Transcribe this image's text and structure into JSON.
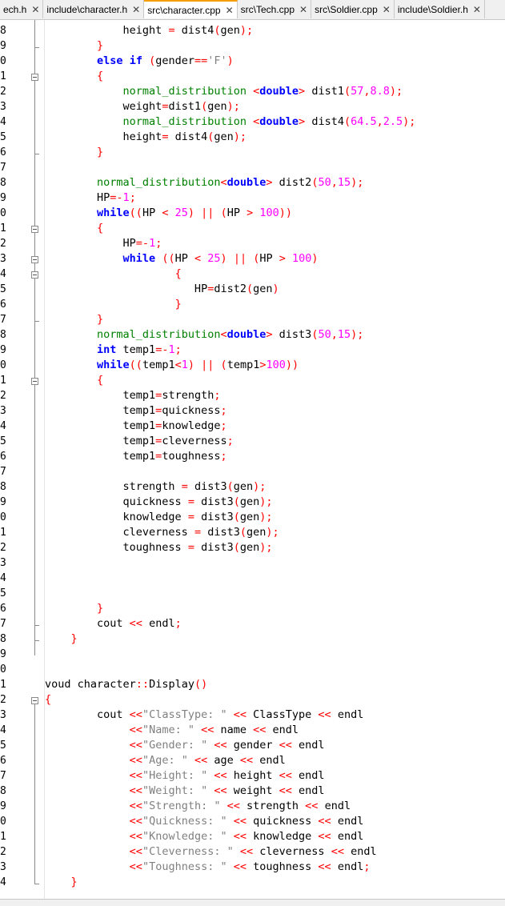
{
  "tabs": [
    {
      "label": "ech.h",
      "close": "✕",
      "active": false
    },
    {
      "label": "include\\character.h",
      "close": "✕",
      "active": false
    },
    {
      "label": "src\\character.cpp",
      "close": "✕",
      "active": true
    },
    {
      "label": "src\\Tech.cpp",
      "close": "✕",
      "active": false
    },
    {
      "label": "src\\Soldier.cpp",
      "close": "✕",
      "active": false
    },
    {
      "label": "include\\Soldier.h",
      "close": "✕",
      "active": false
    }
  ],
  "line_numbers": [
    "8",
    "9",
    "0",
    "1",
    "2",
    "3",
    "4",
    "5",
    "6",
    "7",
    "8",
    "9",
    "0",
    "1",
    "2",
    "3",
    "4",
    "5",
    "6",
    "7",
    "8",
    "9",
    "0",
    "1",
    "2",
    "3",
    "4",
    "5",
    "6",
    "7",
    "8",
    "9",
    "0",
    "1",
    "2",
    "3",
    "4",
    "5",
    "6",
    "7",
    "8",
    "9",
    "0",
    "1",
    "2",
    "3",
    "4",
    "5",
    "6",
    "7",
    "8",
    "9",
    "0",
    "1",
    "2",
    "3",
    "4"
  ],
  "code_lines": [
    [
      {
        "t": "            height "
      },
      {
        "t": "=",
        "c": "op"
      },
      {
        "t": " dist4"
      },
      {
        "t": "(",
        "c": "op"
      },
      {
        "t": "gen"
      },
      {
        "t": ");",
        "c": "op"
      }
    ],
    [
      {
        "t": "        "
      },
      {
        "t": "}",
        "c": "op"
      }
    ],
    [
      {
        "t": "        "
      },
      {
        "t": "else",
        "c": "kw"
      },
      {
        "t": " "
      },
      {
        "t": "if",
        "c": "kw"
      },
      {
        "t": " "
      },
      {
        "t": "(",
        "c": "op"
      },
      {
        "t": "gender"
      },
      {
        "t": "==",
        "c": "op"
      },
      {
        "t": "'F'",
        "c": "str"
      },
      {
        "t": ")",
        "c": "op"
      }
    ],
    [
      {
        "t": "        "
      },
      {
        "t": "{",
        "c": "op"
      }
    ],
    [
      {
        "t": "            "
      },
      {
        "t": "normal_distribution",
        "c": "fn"
      },
      {
        "t": " "
      },
      {
        "t": "<",
        "c": "op"
      },
      {
        "t": "double",
        "c": "ty"
      },
      {
        "t": ">",
        "c": "op"
      },
      {
        "t": " dist1"
      },
      {
        "t": "(",
        "c": "op"
      },
      {
        "t": "57",
        "c": "num"
      },
      {
        "t": ",",
        "c": "op"
      },
      {
        "t": "8.8",
        "c": "num"
      },
      {
        "t": ");",
        "c": "op"
      }
    ],
    [
      {
        "t": "            weight"
      },
      {
        "t": "=",
        "c": "op"
      },
      {
        "t": "dist1"
      },
      {
        "t": "(",
        "c": "op"
      },
      {
        "t": "gen"
      },
      {
        "t": ");",
        "c": "op"
      }
    ],
    [
      {
        "t": "            "
      },
      {
        "t": "normal_distribution",
        "c": "fn"
      },
      {
        "t": " "
      },
      {
        "t": "<",
        "c": "op"
      },
      {
        "t": "double",
        "c": "ty"
      },
      {
        "t": ">",
        "c": "op"
      },
      {
        "t": " dist4"
      },
      {
        "t": "(",
        "c": "op"
      },
      {
        "t": "64.5",
        "c": "num"
      },
      {
        "t": ",",
        "c": "op"
      },
      {
        "t": "2.5",
        "c": "num"
      },
      {
        "t": ");",
        "c": "op"
      }
    ],
    [
      {
        "t": "            height"
      },
      {
        "t": "=",
        "c": "op"
      },
      {
        "t": " dist4"
      },
      {
        "t": "(",
        "c": "op"
      },
      {
        "t": "gen"
      },
      {
        "t": ");",
        "c": "op"
      }
    ],
    [
      {
        "t": "        "
      },
      {
        "t": "}",
        "c": "op"
      }
    ],
    [
      {
        "t": ""
      }
    ],
    [
      {
        "t": "        "
      },
      {
        "t": "normal_distribution",
        "c": "fn"
      },
      {
        "t": "<",
        "c": "op"
      },
      {
        "t": "double",
        "c": "ty"
      },
      {
        "t": ">",
        "c": "op"
      },
      {
        "t": " dist2"
      },
      {
        "t": "(",
        "c": "op"
      },
      {
        "t": "50",
        "c": "num"
      },
      {
        "t": ",",
        "c": "op"
      },
      {
        "t": "15",
        "c": "num"
      },
      {
        "t": ");",
        "c": "op"
      }
    ],
    [
      {
        "t": "        HP"
      },
      {
        "t": "=-",
        "c": "op"
      },
      {
        "t": "1",
        "c": "num"
      },
      {
        "t": ";",
        "c": "op"
      }
    ],
    [
      {
        "t": "        "
      },
      {
        "t": "while",
        "c": "kw"
      },
      {
        "t": "((",
        "c": "op"
      },
      {
        "t": "HP "
      },
      {
        "t": "<",
        "c": "op"
      },
      {
        "t": " "
      },
      {
        "t": "25",
        "c": "num"
      },
      {
        "t": ")",
        "c": "op"
      },
      {
        "t": " "
      },
      {
        "t": "||",
        "c": "op"
      },
      {
        "t": " "
      },
      {
        "t": "(",
        "c": "op"
      },
      {
        "t": "HP "
      },
      {
        "t": ">",
        "c": "op"
      },
      {
        "t": " "
      },
      {
        "t": "100",
        "c": "num"
      },
      {
        "t": "))",
        "c": "op"
      }
    ],
    [
      {
        "t": "        "
      },
      {
        "t": "{",
        "c": "op"
      }
    ],
    [
      {
        "t": "            HP"
      },
      {
        "t": "=-",
        "c": "op"
      },
      {
        "t": "1",
        "c": "num"
      },
      {
        "t": ";",
        "c": "op"
      }
    ],
    [
      {
        "t": "            "
      },
      {
        "t": "while",
        "c": "kw"
      },
      {
        "t": " "
      },
      {
        "t": "((",
        "c": "op"
      },
      {
        "t": "HP "
      },
      {
        "t": "<",
        "c": "op"
      },
      {
        "t": " "
      },
      {
        "t": "25",
        "c": "num"
      },
      {
        "t": ")",
        "c": "op"
      },
      {
        "t": " "
      },
      {
        "t": "||",
        "c": "op"
      },
      {
        "t": " "
      },
      {
        "t": "(",
        "c": "op"
      },
      {
        "t": "HP "
      },
      {
        "t": ">",
        "c": "op"
      },
      {
        "t": " "
      },
      {
        "t": "100",
        "c": "num"
      },
      {
        "t": ")",
        "c": "op"
      }
    ],
    [
      {
        "t": "                    "
      },
      {
        "t": "{",
        "c": "op"
      }
    ],
    [
      {
        "t": "                       HP"
      },
      {
        "t": "=",
        "c": "op"
      },
      {
        "t": "dist2"
      },
      {
        "t": "(",
        "c": "op"
      },
      {
        "t": "gen"
      },
      {
        "t": ")",
        "c": "op"
      }
    ],
    [
      {
        "t": "                    "
      },
      {
        "t": "}",
        "c": "op"
      }
    ],
    [
      {
        "t": "        "
      },
      {
        "t": "}",
        "c": "op"
      }
    ],
    [
      {
        "t": "        "
      },
      {
        "t": "normal_distribution",
        "c": "fn"
      },
      {
        "t": "<",
        "c": "op"
      },
      {
        "t": "double",
        "c": "ty"
      },
      {
        "t": ">",
        "c": "op"
      },
      {
        "t": " dist3"
      },
      {
        "t": "(",
        "c": "op"
      },
      {
        "t": "50",
        "c": "num"
      },
      {
        "t": ",",
        "c": "op"
      },
      {
        "t": "15",
        "c": "num"
      },
      {
        "t": ");",
        "c": "op"
      }
    ],
    [
      {
        "t": "        "
      },
      {
        "t": "int",
        "c": "ty"
      },
      {
        "t": " temp1"
      },
      {
        "t": "=-",
        "c": "op"
      },
      {
        "t": "1",
        "c": "num"
      },
      {
        "t": ";",
        "c": "op"
      }
    ],
    [
      {
        "t": "        "
      },
      {
        "t": "while",
        "c": "kw"
      },
      {
        "t": "((",
        "c": "op"
      },
      {
        "t": "temp1"
      },
      {
        "t": "<",
        "c": "op"
      },
      {
        "t": "1",
        "c": "num"
      },
      {
        "t": ")",
        "c": "op"
      },
      {
        "t": " "
      },
      {
        "t": "||",
        "c": "op"
      },
      {
        "t": " "
      },
      {
        "t": "(",
        "c": "op"
      },
      {
        "t": "temp1"
      },
      {
        "t": ">",
        "c": "op"
      },
      {
        "t": "100",
        "c": "num"
      },
      {
        "t": "))",
        "c": "op"
      }
    ],
    [
      {
        "t": "        "
      },
      {
        "t": "{",
        "c": "op"
      }
    ],
    [
      {
        "t": "            temp1"
      },
      {
        "t": "=",
        "c": "op"
      },
      {
        "t": "strength"
      },
      {
        "t": ";",
        "c": "op"
      }
    ],
    [
      {
        "t": "            temp1"
      },
      {
        "t": "=",
        "c": "op"
      },
      {
        "t": "quickness"
      },
      {
        "t": ";",
        "c": "op"
      }
    ],
    [
      {
        "t": "            temp1"
      },
      {
        "t": "=",
        "c": "op"
      },
      {
        "t": "knowledge"
      },
      {
        "t": ";",
        "c": "op"
      }
    ],
    [
      {
        "t": "            temp1"
      },
      {
        "t": "=",
        "c": "op"
      },
      {
        "t": "cleverness"
      },
      {
        "t": ";",
        "c": "op"
      }
    ],
    [
      {
        "t": "            temp1"
      },
      {
        "t": "=",
        "c": "op"
      },
      {
        "t": "toughness"
      },
      {
        "t": ";",
        "c": "op"
      }
    ],
    [
      {
        "t": ""
      }
    ],
    [
      {
        "t": "            strength "
      },
      {
        "t": "=",
        "c": "op"
      },
      {
        "t": " dist3"
      },
      {
        "t": "(",
        "c": "op"
      },
      {
        "t": "gen"
      },
      {
        "t": ");",
        "c": "op"
      }
    ],
    [
      {
        "t": "            quickness "
      },
      {
        "t": "=",
        "c": "op"
      },
      {
        "t": " dist3"
      },
      {
        "t": "(",
        "c": "op"
      },
      {
        "t": "gen"
      },
      {
        "t": ");",
        "c": "op"
      }
    ],
    [
      {
        "t": "            knowledge "
      },
      {
        "t": "=",
        "c": "op"
      },
      {
        "t": " dist3"
      },
      {
        "t": "(",
        "c": "op"
      },
      {
        "t": "gen"
      },
      {
        "t": ");",
        "c": "op"
      }
    ],
    [
      {
        "t": "            cleverness "
      },
      {
        "t": "=",
        "c": "op"
      },
      {
        "t": " dist3"
      },
      {
        "t": "(",
        "c": "op"
      },
      {
        "t": "gen"
      },
      {
        "t": ");",
        "c": "op"
      }
    ],
    [
      {
        "t": "            toughness "
      },
      {
        "t": "=",
        "c": "op"
      },
      {
        "t": " dist3"
      },
      {
        "t": "(",
        "c": "op"
      },
      {
        "t": "gen"
      },
      {
        "t": ");",
        "c": "op"
      }
    ],
    [
      {
        "t": ""
      }
    ],
    [
      {
        "t": ""
      }
    ],
    [
      {
        "t": ""
      }
    ],
    [
      {
        "t": "        "
      },
      {
        "t": "}",
        "c": "op"
      }
    ],
    [
      {
        "t": "        cout "
      },
      {
        "t": "<<",
        "c": "op"
      },
      {
        "t": " endl"
      },
      {
        "t": ";",
        "c": "op"
      }
    ],
    [
      {
        "t": "    "
      },
      {
        "t": "}",
        "c": "op"
      }
    ],
    [
      {
        "t": ""
      }
    ],
    [
      {
        "t": ""
      }
    ],
    [
      {
        "t": "voud character"
      },
      {
        "t": "::",
        "c": "op"
      },
      {
        "t": "Display"
      },
      {
        "t": "()",
        "c": "op"
      }
    ],
    [
      {
        "t": "{",
        "c": "op"
      }
    ],
    [
      {
        "t": "        cout "
      },
      {
        "t": "<<",
        "c": "op"
      },
      {
        "t": "\"ClassType: \"",
        "c": "str"
      },
      {
        "t": " "
      },
      {
        "t": "<<",
        "c": "op"
      },
      {
        "t": " ClassType "
      },
      {
        "t": "<<",
        "c": "op"
      },
      {
        "t": " endl"
      }
    ],
    [
      {
        "t": "             "
      },
      {
        "t": "<<",
        "c": "op"
      },
      {
        "t": "\"Name: \"",
        "c": "str"
      },
      {
        "t": " "
      },
      {
        "t": "<<",
        "c": "op"
      },
      {
        "t": " name "
      },
      {
        "t": "<<",
        "c": "op"
      },
      {
        "t": " endl"
      }
    ],
    [
      {
        "t": "             "
      },
      {
        "t": "<<",
        "c": "op"
      },
      {
        "t": "\"Gender: \"",
        "c": "str"
      },
      {
        "t": " "
      },
      {
        "t": "<<",
        "c": "op"
      },
      {
        "t": " gender "
      },
      {
        "t": "<<",
        "c": "op"
      },
      {
        "t": " endl"
      }
    ],
    [
      {
        "t": "             "
      },
      {
        "t": "<<",
        "c": "op"
      },
      {
        "t": "\"Age: \"",
        "c": "str"
      },
      {
        "t": " "
      },
      {
        "t": "<<",
        "c": "op"
      },
      {
        "t": " age "
      },
      {
        "t": "<<",
        "c": "op"
      },
      {
        "t": " endl"
      }
    ],
    [
      {
        "t": "             "
      },
      {
        "t": "<<",
        "c": "op"
      },
      {
        "t": "\"Height: \"",
        "c": "str"
      },
      {
        "t": " "
      },
      {
        "t": "<<",
        "c": "op"
      },
      {
        "t": " height "
      },
      {
        "t": "<<",
        "c": "op"
      },
      {
        "t": " endl"
      }
    ],
    [
      {
        "t": "             "
      },
      {
        "t": "<<",
        "c": "op"
      },
      {
        "t": "\"Weight: \"",
        "c": "str"
      },
      {
        "t": " "
      },
      {
        "t": "<<",
        "c": "op"
      },
      {
        "t": " weight "
      },
      {
        "t": "<<",
        "c": "op"
      },
      {
        "t": " endl"
      }
    ],
    [
      {
        "t": "             "
      },
      {
        "t": "<<",
        "c": "op"
      },
      {
        "t": "\"Strength: \"",
        "c": "str"
      },
      {
        "t": " "
      },
      {
        "t": "<<",
        "c": "op"
      },
      {
        "t": " strength "
      },
      {
        "t": "<<",
        "c": "op"
      },
      {
        "t": " endl"
      }
    ],
    [
      {
        "t": "             "
      },
      {
        "t": "<<",
        "c": "op"
      },
      {
        "t": "\"Quickness: \"",
        "c": "str"
      },
      {
        "t": " "
      },
      {
        "t": "<<",
        "c": "op"
      },
      {
        "t": " quickness "
      },
      {
        "t": "<<",
        "c": "op"
      },
      {
        "t": " endl"
      }
    ],
    [
      {
        "t": "             "
      },
      {
        "t": "<<",
        "c": "op"
      },
      {
        "t": "\"Knowledge: \"",
        "c": "str"
      },
      {
        "t": " "
      },
      {
        "t": "<<",
        "c": "op"
      },
      {
        "t": " knowledge "
      },
      {
        "t": "<<",
        "c": "op"
      },
      {
        "t": " endl"
      }
    ],
    [
      {
        "t": "             "
      },
      {
        "t": "<<",
        "c": "op"
      },
      {
        "t": "\"Cleverness: \"",
        "c": "str"
      },
      {
        "t": " "
      },
      {
        "t": "<<",
        "c": "op"
      },
      {
        "t": " cleverness "
      },
      {
        "t": "<<",
        "c": "op"
      },
      {
        "t": " endl"
      }
    ],
    [
      {
        "t": "             "
      },
      {
        "t": "<<",
        "c": "op"
      },
      {
        "t": "\"Toughness: \"",
        "c": "str"
      },
      {
        "t": " "
      },
      {
        "t": "<<",
        "c": "op"
      },
      {
        "t": " toughness "
      },
      {
        "t": "<<",
        "c": "op"
      },
      {
        "t": " endl"
      },
      {
        "t": ";",
        "c": "op"
      }
    ],
    [
      {
        "t": "    "
      },
      {
        "t": "}",
        "c": "op"
      }
    ],
    [
      {
        "t": ""
      }
    ]
  ]
}
